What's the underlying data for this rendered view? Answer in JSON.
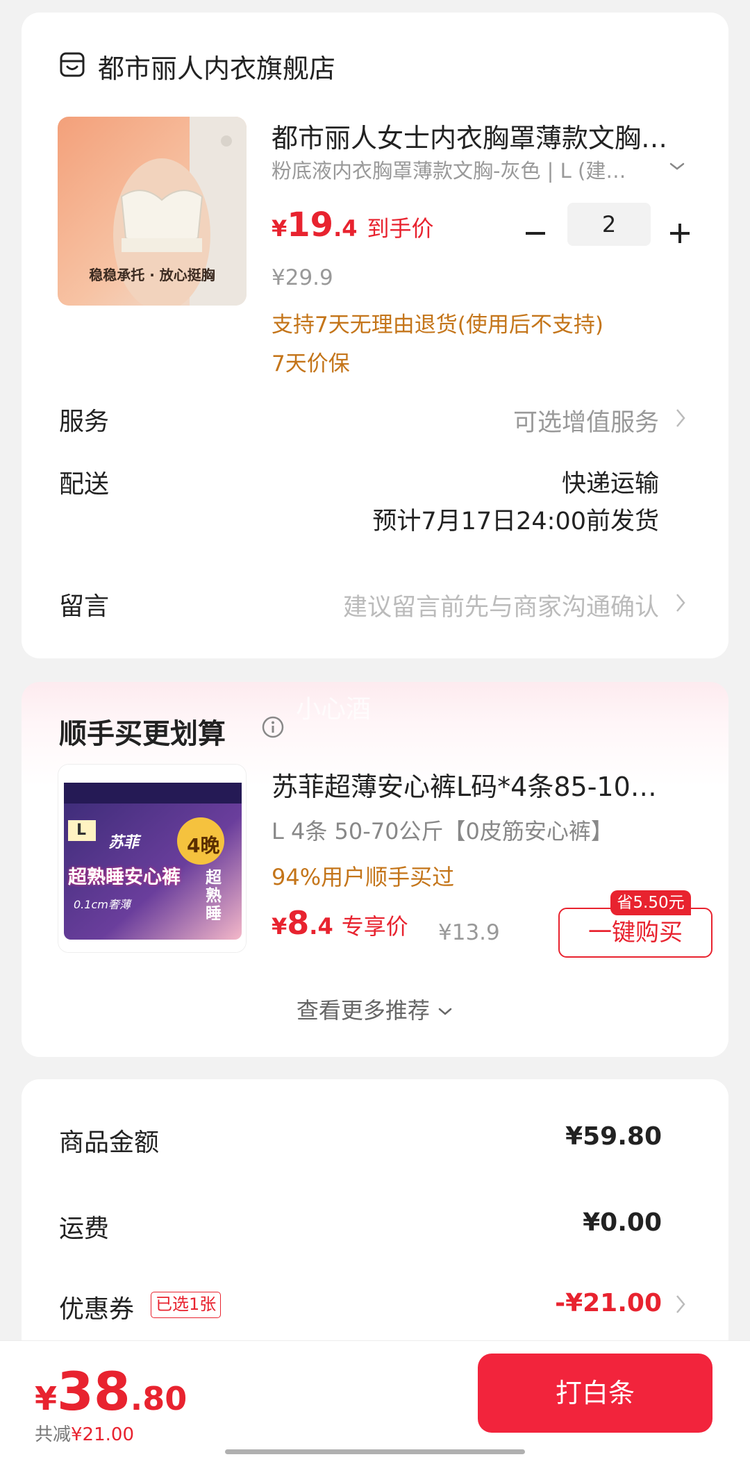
{
  "store": {
    "name": "都市丽人内衣旗舰店",
    "icon": "store-icon"
  },
  "product": {
    "title": "都市丽人女士内衣胸罩薄款文胸…",
    "sku": "粉底液内衣胸罩薄款文胸-灰色 | L (建…",
    "image_caption": "稳稳承托 · 放心挺胸",
    "price_symbol": "¥",
    "price_integer": "19",
    "price_decimal": ".4",
    "price_tag": "到手价",
    "original_price": "¥29.9",
    "quantity": "2",
    "policy_return": "支持7天无理由退货(使用后不支持)",
    "policy_price_protect": "7天价保"
  },
  "service": {
    "label": "服务",
    "value": "可选增值服务"
  },
  "delivery": {
    "label": "配送",
    "method": "快递运输",
    "eta": "预计7月17日24:00前发货"
  },
  "message": {
    "label": "留言",
    "placeholder": "建议留言前先与商家沟通确认"
  },
  "recommend": {
    "hidden_label": "小心酒",
    "title": "顺手买更划算",
    "item": {
      "name": "苏菲超薄安心裤L码*4条85-10…",
      "sku": "L 4条 50-70公斤【0皮筋安心裤】",
      "social_proof": "94%用户顺手买过",
      "price_symbol": "¥",
      "price_integer": "8",
      "price_decimal": ".4",
      "price_tag": "专享价",
      "original_price": "¥13.9",
      "save_badge": "省5.50元",
      "buy_button": "一键购买",
      "image_text_brand": "苏菲",
      "image_text_main": "超熟睡安心裤",
      "image_text_side": "超熟睡",
      "image_text_count": "4晚",
      "image_text_size": "L",
      "image_text_thin": "0.1cm奢薄"
    },
    "see_more": "查看更多推荐"
  },
  "summary": {
    "goods_label": "商品金额",
    "goods_value": "¥59.80",
    "shipping_label": "运费",
    "shipping_value": "¥0.00",
    "coupon_label": "优惠券",
    "coupon_badge": "已选1张",
    "coupon_value": "-¥21.00"
  },
  "checkout": {
    "currency": "¥",
    "total_integer": "38",
    "total_decimal": ".80",
    "discount_label": "共减",
    "discount_value": "¥21.00",
    "pay_button": "打白条"
  },
  "colors": {
    "accent_red": "#e8232f",
    "pay_button": "#f2243c",
    "policy_orange": "#c4751a",
    "background": "#f2f2f2"
  }
}
